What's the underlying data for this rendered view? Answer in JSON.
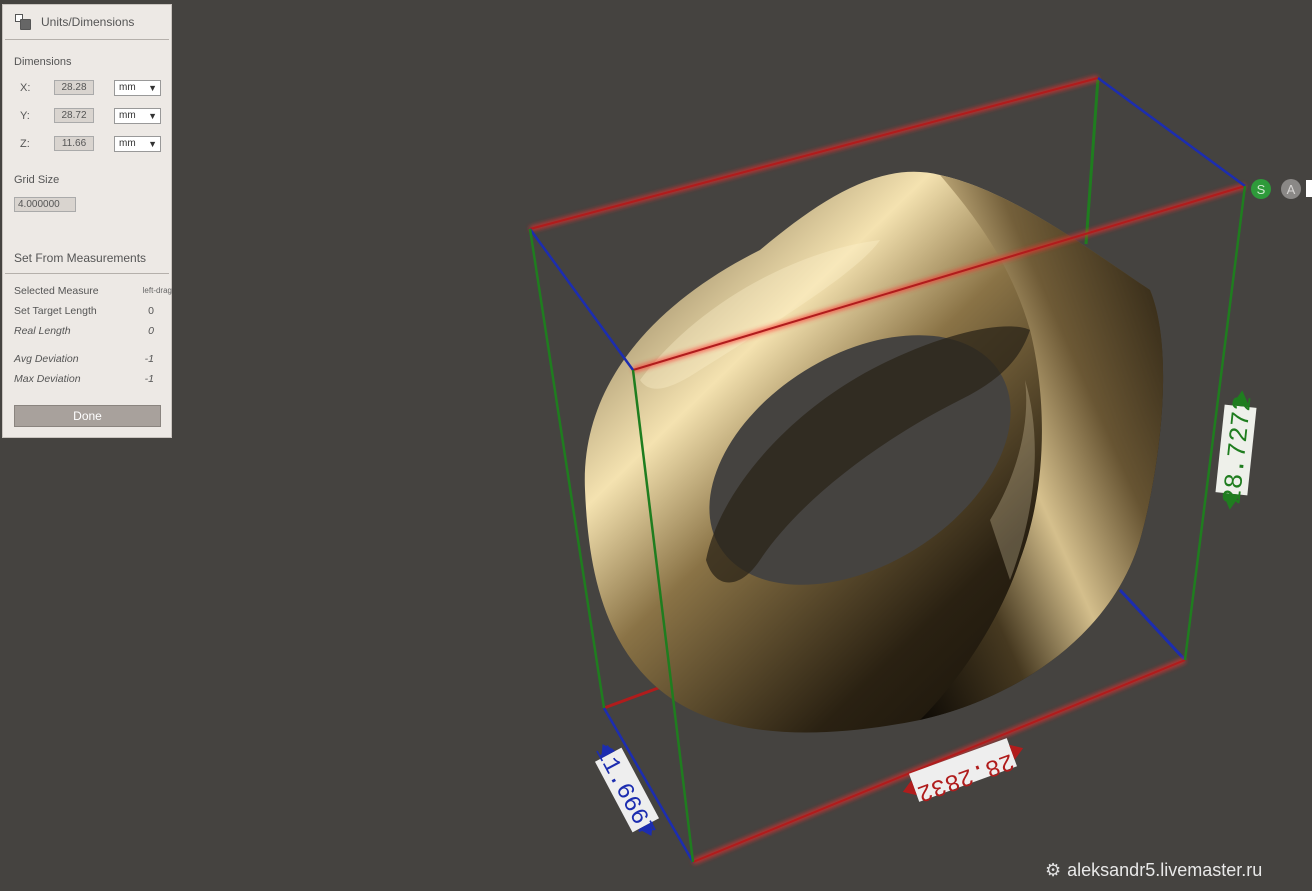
{
  "panel": {
    "title": "Units/Dimensions",
    "dimensions_label": "Dimensions",
    "rows": [
      {
        "axis": "X:",
        "value": "28.28",
        "unit": "mm"
      },
      {
        "axis": "Y:",
        "value": "28.72",
        "unit": "mm"
      },
      {
        "axis": "Z:",
        "value": "11.66",
        "unit": "mm"
      }
    ],
    "grid_size_label": "Grid Size",
    "grid_size_value": "4.000000",
    "measurements_header": "Set From Measurements",
    "selected_measure_label": "Selected Measure",
    "selected_measure_value": "left-drag",
    "target_length_label": "Set Target Length",
    "target_length_value": "0",
    "real_length_label": "Real Length",
    "real_length_value": "0",
    "avg_deviation_label": "Avg Deviation",
    "avg_deviation_value": "-1",
    "max_deviation_label": "Max Deviation",
    "max_deviation_value": "-1",
    "done_label": "Done"
  },
  "viewport": {
    "label_x": "28.2832",
    "label_y": "28.7272",
    "label_z": "11.6667",
    "btn_s": "S",
    "btn_a": "A",
    "colors": {
      "x_axis": "#b01c1c",
      "y_axis": "#1f7d1f",
      "z_axis": "#1c2db0",
      "background": "#454340"
    }
  },
  "watermark": "aleksandr5.livemaster.ru"
}
